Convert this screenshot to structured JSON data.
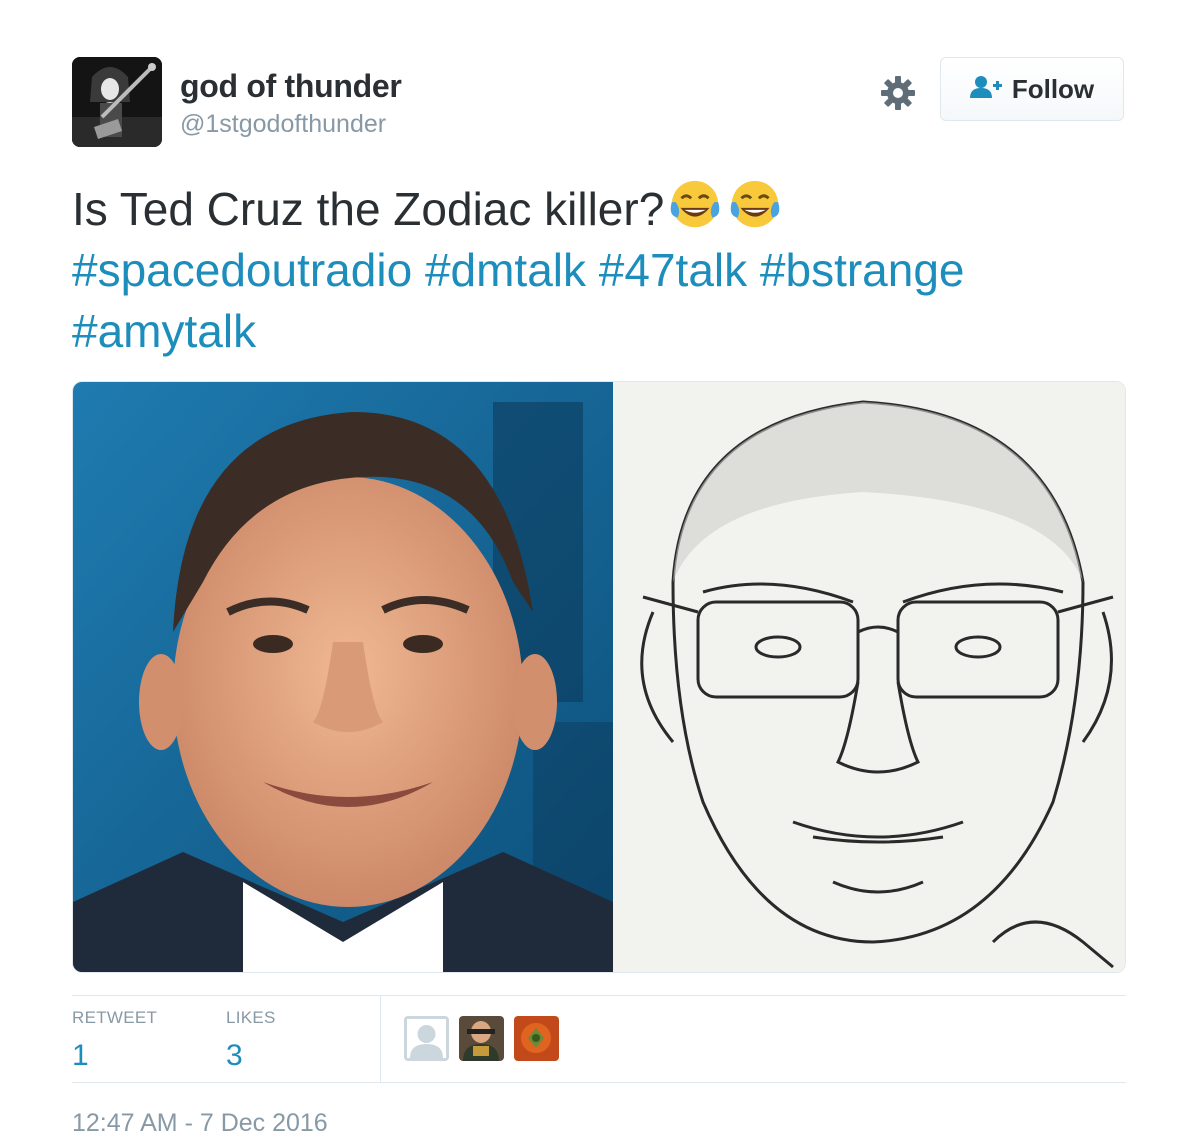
{
  "user": {
    "display_name": "god of thunder",
    "handle": "@1stgodofthunder",
    "avatar_icon": "avatar-guitarist-photo"
  },
  "actions": {
    "settings_icon": "gear-icon",
    "follow_icon": "add-user-icon",
    "follow_label": "Follow"
  },
  "tweet": {
    "text": "Is Ted Cruz the Zodiac killer?",
    "emojis": [
      "face-with-tears-of-joy",
      "face-with-tears-of-joy"
    ],
    "hashtags": [
      "#spacedoutradio",
      "#dmtalk",
      "#47talk",
      "#bstrange",
      "#amytalk"
    ],
    "link_color": "#1d8dbc"
  },
  "media": {
    "left_photo": "portrait-photo-man-smiling",
    "right_photo": "pencil-sketch-composite-portrait-with-glasses"
  },
  "stats": {
    "retweet_label": "RETWEET",
    "retweet_count": "1",
    "likes_label": "LIKES",
    "likes_count": "3"
  },
  "likers": [
    "default-avatar",
    "liker-avatar-photo",
    "liker-avatar-orange"
  ],
  "timestamp": "12:47 AM - 7 Dec 2016"
}
